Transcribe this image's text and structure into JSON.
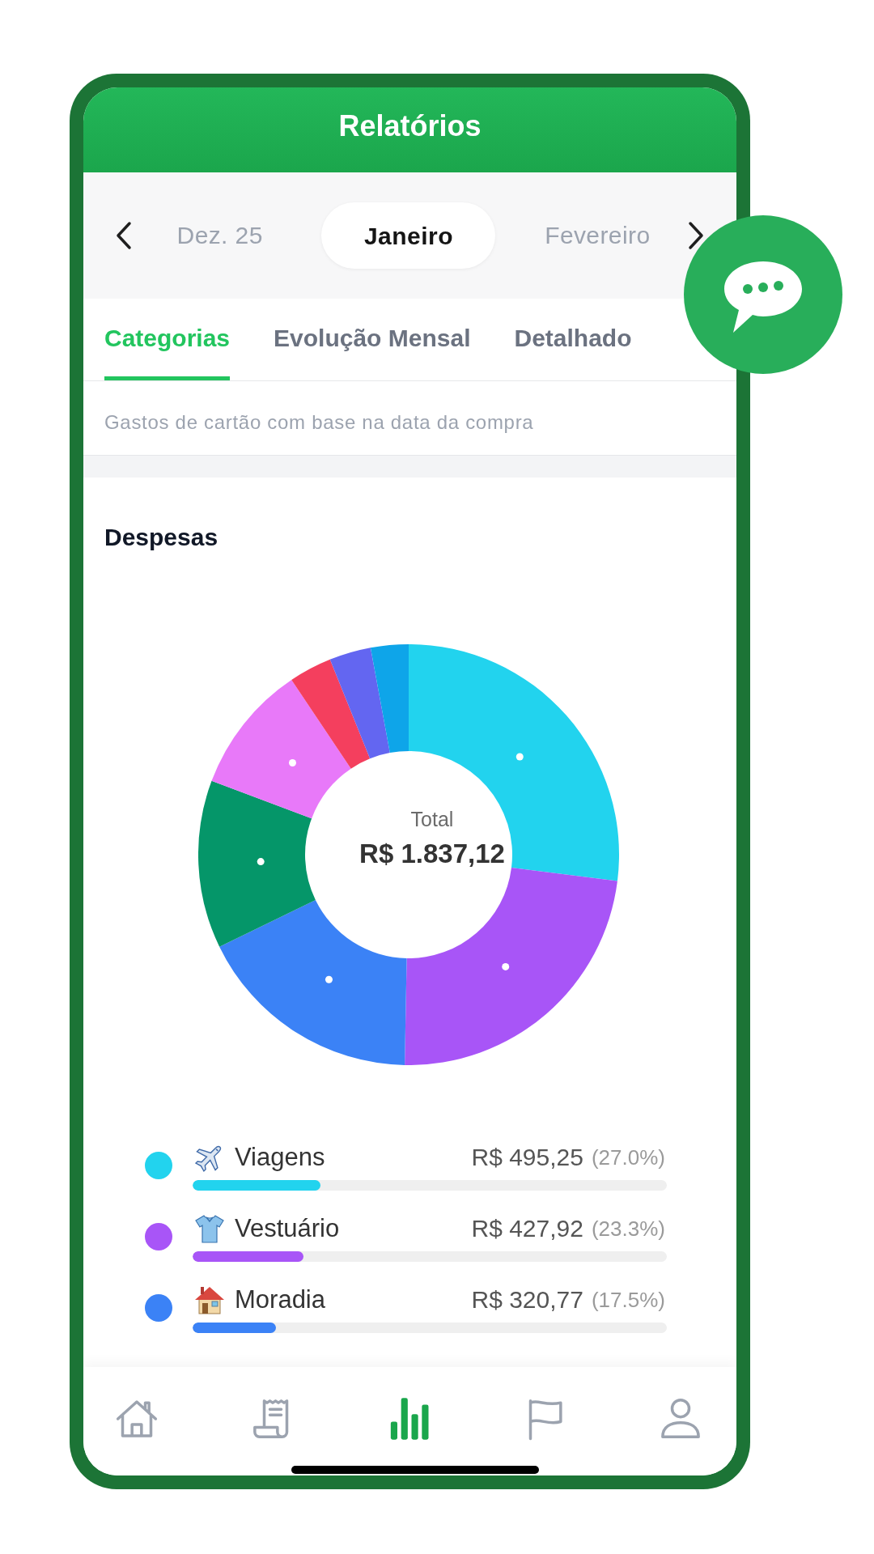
{
  "header": {
    "title": "Relatórios"
  },
  "months": [
    {
      "label": "Dez. 25",
      "selected": false
    },
    {
      "label": "Janeiro",
      "selected": true
    },
    {
      "label": "Fevereiro",
      "selected": false
    }
  ],
  "tabs": [
    {
      "label": "Categorias",
      "selected": true
    },
    {
      "label": "Evolução Mensal",
      "selected": false
    },
    {
      "label": "Detalhado",
      "selected": false
    }
  ],
  "note": "Gastos de cartão com base na data da compra",
  "expenses": {
    "title": "Despesas",
    "total_label": "Total",
    "total_value": "R$ 1.837,12",
    "categories": [
      {
        "name": "Viagens",
        "amount": "R$ 495,25",
        "percent": "(27.0%)",
        "level": 0.27,
        "color": "#22d3ee"
      },
      {
        "name": "Vestuário",
        "amount": "R$ 427,92",
        "percent": "(23.3%)",
        "level": 0.233,
        "color": "#a855f7"
      },
      {
        "name": "Moradia",
        "amount": "R$ 320,77",
        "percent": "(17.5%)",
        "level": 0.175,
        "color": "#3b82f6"
      }
    ]
  },
  "bottom_nav": [
    {
      "selected": false
    },
    {
      "selected": false
    },
    {
      "selected": true
    },
    {
      "selected": false
    },
    {
      "selected": false
    }
  ]
}
